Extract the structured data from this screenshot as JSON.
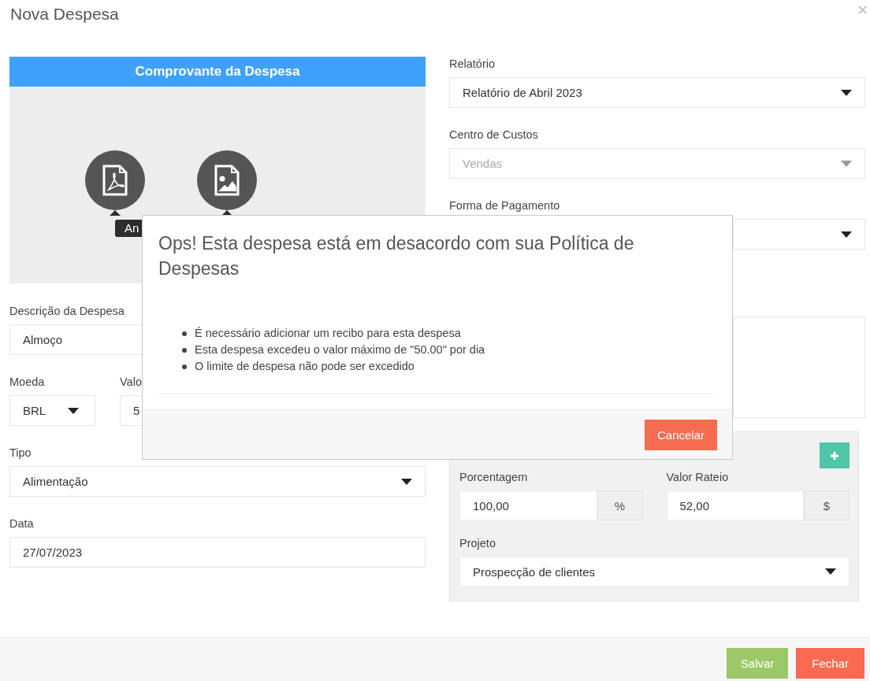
{
  "dialog": {
    "title": "Nova Despesa",
    "close": "×"
  },
  "receipt": {
    "title": "Comprovante da Despesa",
    "tooltip": "An"
  },
  "description": {
    "label": "Descrição da Despesa",
    "value": "Almoço"
  },
  "currency": {
    "label": "Moeda",
    "value": "BRL"
  },
  "amount": {
    "label": "Valo",
    "value": "5"
  },
  "type": {
    "label": "Tipo",
    "value": "Alimentação"
  },
  "date": {
    "label": "Data",
    "value": "27/07/2023"
  },
  "report": {
    "label": "Relatório",
    "value": "Relatório de Abril 2023",
    "disabled": false
  },
  "cost_center": {
    "label": "Centro de Custos",
    "value": "Vendas",
    "disabled": true
  },
  "payment": {
    "label": "Forma de Pagamento"
  },
  "allocation": {
    "percent": {
      "label": "Porcentagem",
      "value": "100,00",
      "unit": "%"
    },
    "value": {
      "label": "Valor Rateio",
      "value": "52,00",
      "unit": "$"
    },
    "project": {
      "label": "Projeto",
      "value": "Prospecção de clientes"
    }
  },
  "alert": {
    "title": "Ops! Esta despesa está em desacordo com sua Política de Despesas",
    "items": [
      "É necessário adicionar um recibo para esta despesa",
      "Esta despesa excedeu o valor máximo de \"50.00\" por dia",
      "O limite de despesa não pode ser excedido"
    ],
    "button": "Cancelar"
  },
  "footer_buttons": [
    {
      "label": "Salvar",
      "kind": "save"
    },
    {
      "label": "Fechar",
      "kind": "close"
    }
  ]
}
